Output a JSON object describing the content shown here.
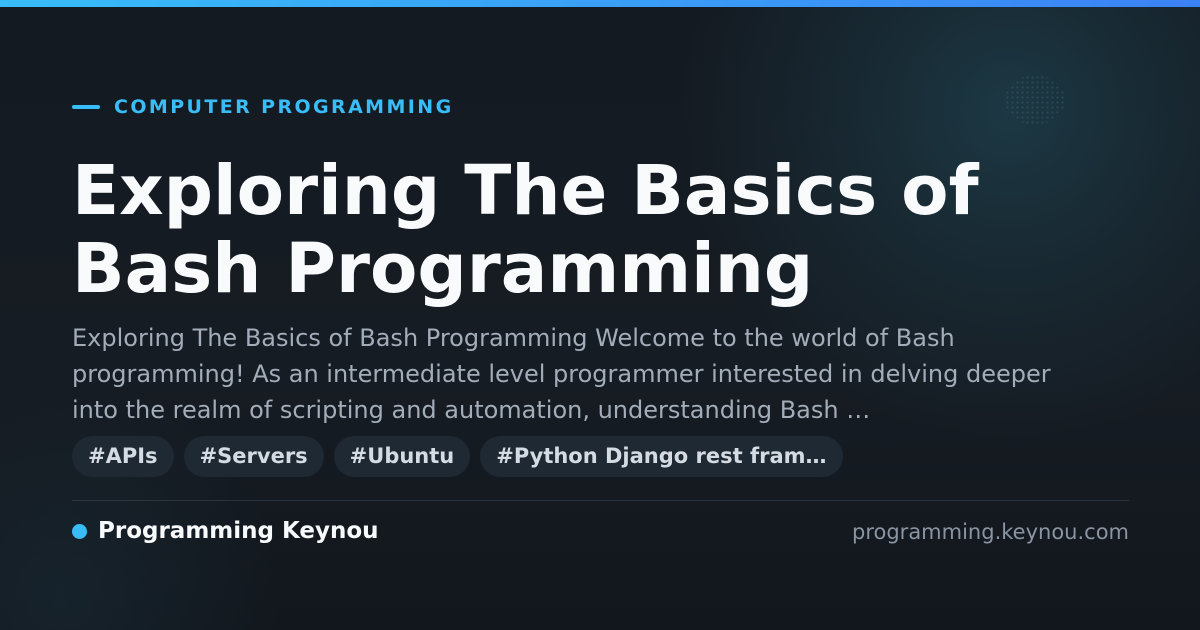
{
  "category": "COMPUTER PROGRAMMING",
  "title_line_1": "Exploring The Basics of",
  "title_line_2": "Bash Programming",
  "excerpt": "Exploring The Basics of Bash Programming Welcome to the world of Bash programming! As an intermediate level programmer interested in delving deeper into the realm of scripting and automation, understanding Bash …",
  "tags": [
    "#APIs",
    "#Servers",
    "#Ubuntu",
    "#Python Django rest fram…"
  ],
  "brand": "Programming Keynou",
  "site": "programming.keynou.com",
  "colors": {
    "accent": "#38bdf8",
    "background": "#151b22",
    "title": "#f8fafc",
    "muted": "#a3acb9"
  }
}
